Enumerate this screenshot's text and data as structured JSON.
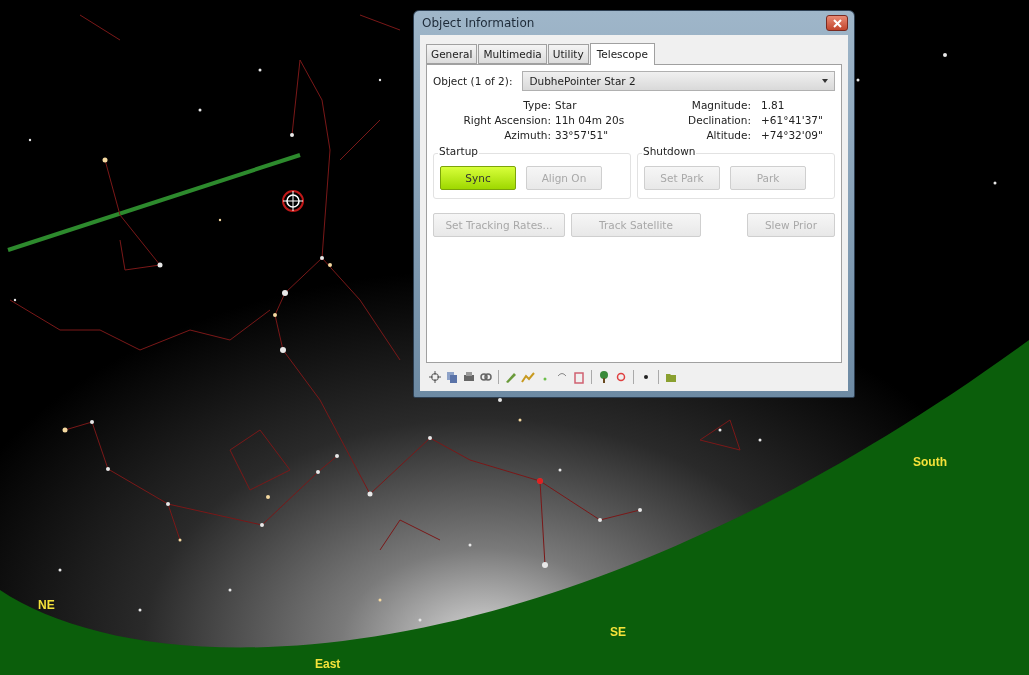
{
  "compass_labels": [
    "NE",
    "East",
    "SE",
    "South"
  ],
  "window": {
    "title": "Object Information"
  },
  "tabs": [
    {
      "label": "General",
      "selected": false
    },
    {
      "label": "Multimedia",
      "selected": false
    },
    {
      "label": "Utility",
      "selected": false
    },
    {
      "label": "Telescope",
      "selected": true
    }
  ],
  "object_select": {
    "label": "Object (1 of 2):",
    "value": "DubhePointer Star 2"
  },
  "properties": [
    {
      "label": "Type:",
      "value": "Star",
      "label_2": "Magnitude:",
      "value_2": "1.81"
    },
    {
      "label": "Right Ascension:",
      "value": "11h 04m 20s",
      "label_2": "Declination:",
      "value_2": "+61°41'37\""
    },
    {
      "label": "Azimuth:",
      "value": "33°57'51\"",
      "label_2": "Altitude:",
      "value_2": "+74°32'09\""
    }
  ],
  "groups": [
    {
      "title": "Startup",
      "buttons": [
        {
          "label": "Sync",
          "highlighted": true,
          "disabled": false
        },
        {
          "label": "Align On",
          "highlighted": false,
          "disabled": true
        }
      ]
    },
    {
      "title": "Shutdown",
      "buttons": [
        {
          "label": "Set Park",
          "highlighted": false,
          "disabled": true
        },
        {
          "label": "Park",
          "highlighted": false,
          "disabled": true
        }
      ]
    }
  ],
  "actions": [
    {
      "label": "Set Tracking Rates...",
      "disabled": true
    },
    {
      "label": "Track Satellite",
      "disabled": true
    },
    {
      "label": "Slew Prior",
      "disabled": true
    }
  ]
}
